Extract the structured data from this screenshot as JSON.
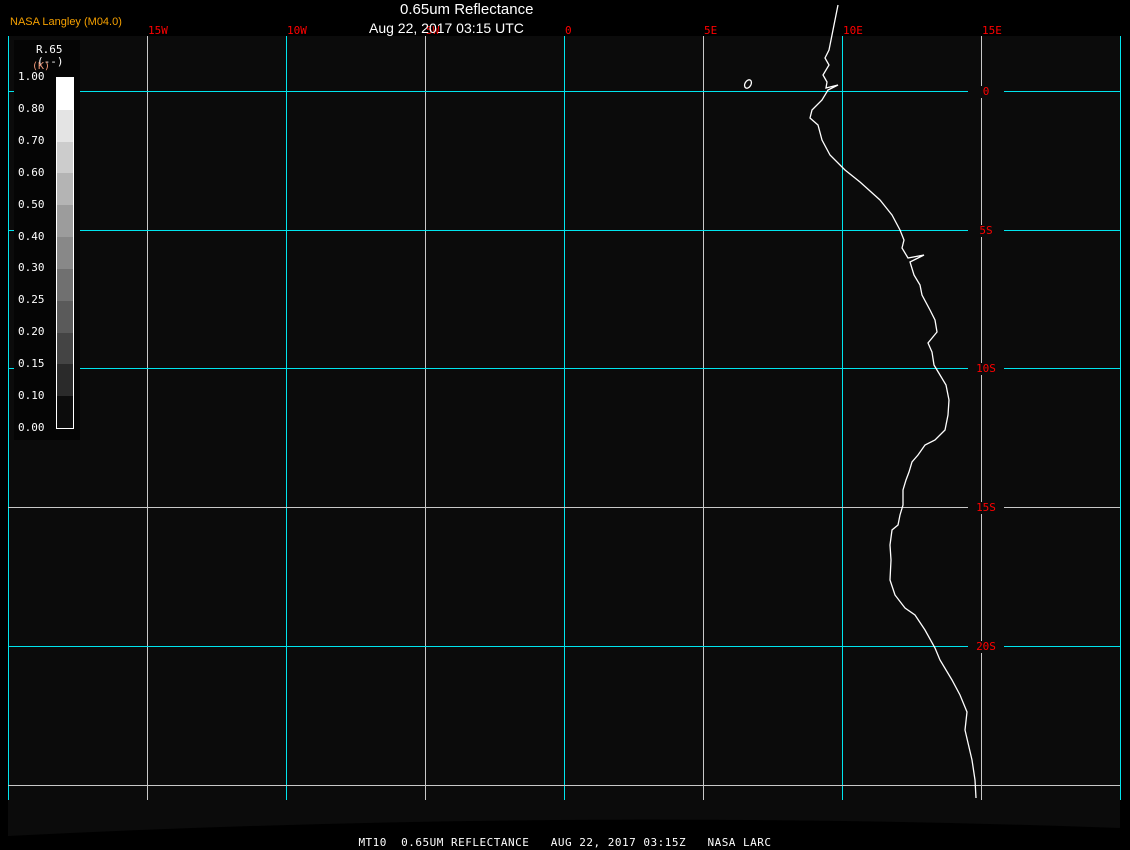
{
  "header": {
    "title": "0.65um Reflectance",
    "subtitle": "Aug 22, 2017 03:15 UTC",
    "brand": "NASA Langley (M04.0)"
  },
  "footer": "MT10  0.65UM REFLECTANCE   AUG 22, 2017 03:15Z   NASA LARC",
  "legend": {
    "variable": "R.65",
    "units": "(--)",
    "unit_overlay": "(K)",
    "ticks": [
      "1.00",
      "0.80",
      "0.70",
      "0.60",
      "0.50",
      "0.40",
      "0.30",
      "0.25",
      "0.20",
      "0.15",
      "0.10",
      "0.00"
    ],
    "colors": [
      "#ffffff",
      "#e4e4e4",
      "#cccccc",
      "#b4b4b4",
      "#9c9c9c",
      "#888888",
      "#707070",
      "#5a5a5a",
      "#444444",
      "#2a2a2a",
      "#0c0c0c"
    ]
  },
  "map": {
    "longitude_labels": [
      "15W",
      "10W",
      "5W",
      "0",
      "5E",
      "10E",
      "15E"
    ],
    "latitude_labels": [
      "0",
      "5S",
      "10S",
      "15S",
      "20S"
    ],
    "grid_color": "#00e5ee",
    "grid_minor_color": "#c8c8c8",
    "label_color": "#ff0000",
    "coastline_color": "#ffffff"
  }
}
